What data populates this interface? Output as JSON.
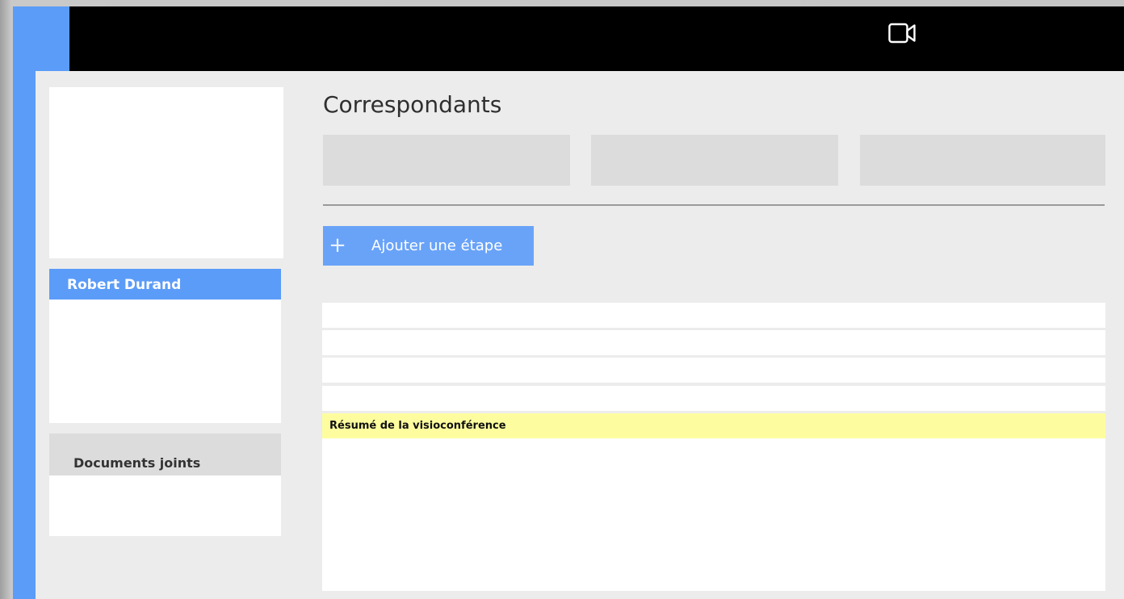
{
  "header": {
    "video_icon": "video-camera-icon"
  },
  "sidebar": {
    "contact_name": "Robert Durand",
    "documents_label": "Documents joints"
  },
  "main": {
    "title": "Correspondants",
    "correspondents": [
      "",
      "",
      ""
    ],
    "add_step": {
      "icon": "plus-icon",
      "label": "Ajouter une étape"
    },
    "steps": [
      "",
      "",
      "",
      ""
    ],
    "summary_label": "Résumé de la visioconférence"
  },
  "colors": {
    "accent": "#5b9cf8",
    "button": "#69a3f8",
    "header_bar": "#000000",
    "summary_highlight": "#fdfd9f"
  }
}
